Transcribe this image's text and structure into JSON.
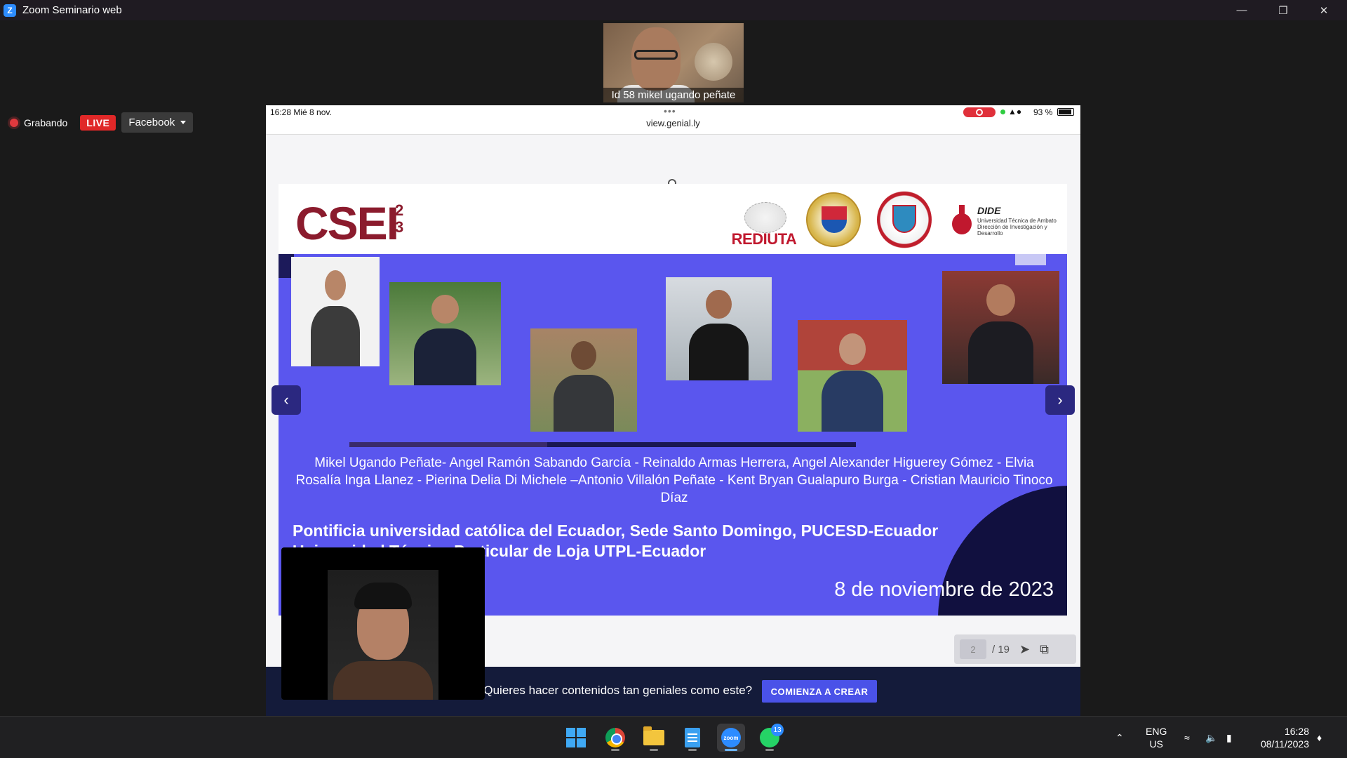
{
  "window": {
    "title": "Zoom Seminario web"
  },
  "top_participant": {
    "name": "Id 58 mikel ugando peñate"
  },
  "recording": {
    "status": "Grabando",
    "live_badge": "LIVE",
    "stream_target": "Facebook"
  },
  "shared_screen": {
    "status_time": "16:28   Mié 8 nov.",
    "url": "view.genial.ly",
    "battery": "93 %",
    "slide": {
      "logo_text": "CSEI",
      "logo_sup_1": "2",
      "logo_sup_2": "3",
      "partner_logos": {
        "rediuta": "REDIUTA",
        "dide": "DIDE",
        "dide_sub": "Universidad Técnica de Ambato Dirección de Investigación y Desarrollo"
      },
      "authors": "Mikel Ugando Peñate- Angel Ramón Sabando García - Reinaldo Armas Herrera, Angel Alexander Higuerey Gómez - Elvia Rosalía Inga Llanez - Pierina Delia Di Michele –Antonio Villalón Peñate - Kent Bryan Gualapuro Burga - Cristian Mauricio Tinoco Díaz",
      "affiliation_1": "Pontificia universidad católica del Ecuador, Sede Santo Domingo, PUCESD-Ecuador",
      "affiliation_2": "Universidad Técnica Particular de Loja UTPL-Ecuador",
      "date": "8 de noviembre de 2023",
      "progress_fraction": 0.39
    },
    "pager": {
      "current": "2",
      "total": "/  19"
    },
    "cta": {
      "text": "¿Quieres hacer contenidos tan geniales como este?",
      "button": "COMIENZA A CREAR"
    }
  },
  "taskbar": {
    "icons": [
      "windows-start-icon",
      "chrome-icon",
      "file-explorer-icon",
      "notepad-icon",
      "zoom-icon",
      "whatsapp-icon"
    ],
    "whatsapp_badge": "13",
    "lang_1": "ENG",
    "lang_2": "US",
    "clock_time": "16:28",
    "clock_date": "08/11/2023"
  },
  "colors": {
    "slide_bg": "#5a56ee",
    "dark_navy": "#11103f",
    "cta_button": "#4a52e8",
    "live_red": "#e02828"
  }
}
